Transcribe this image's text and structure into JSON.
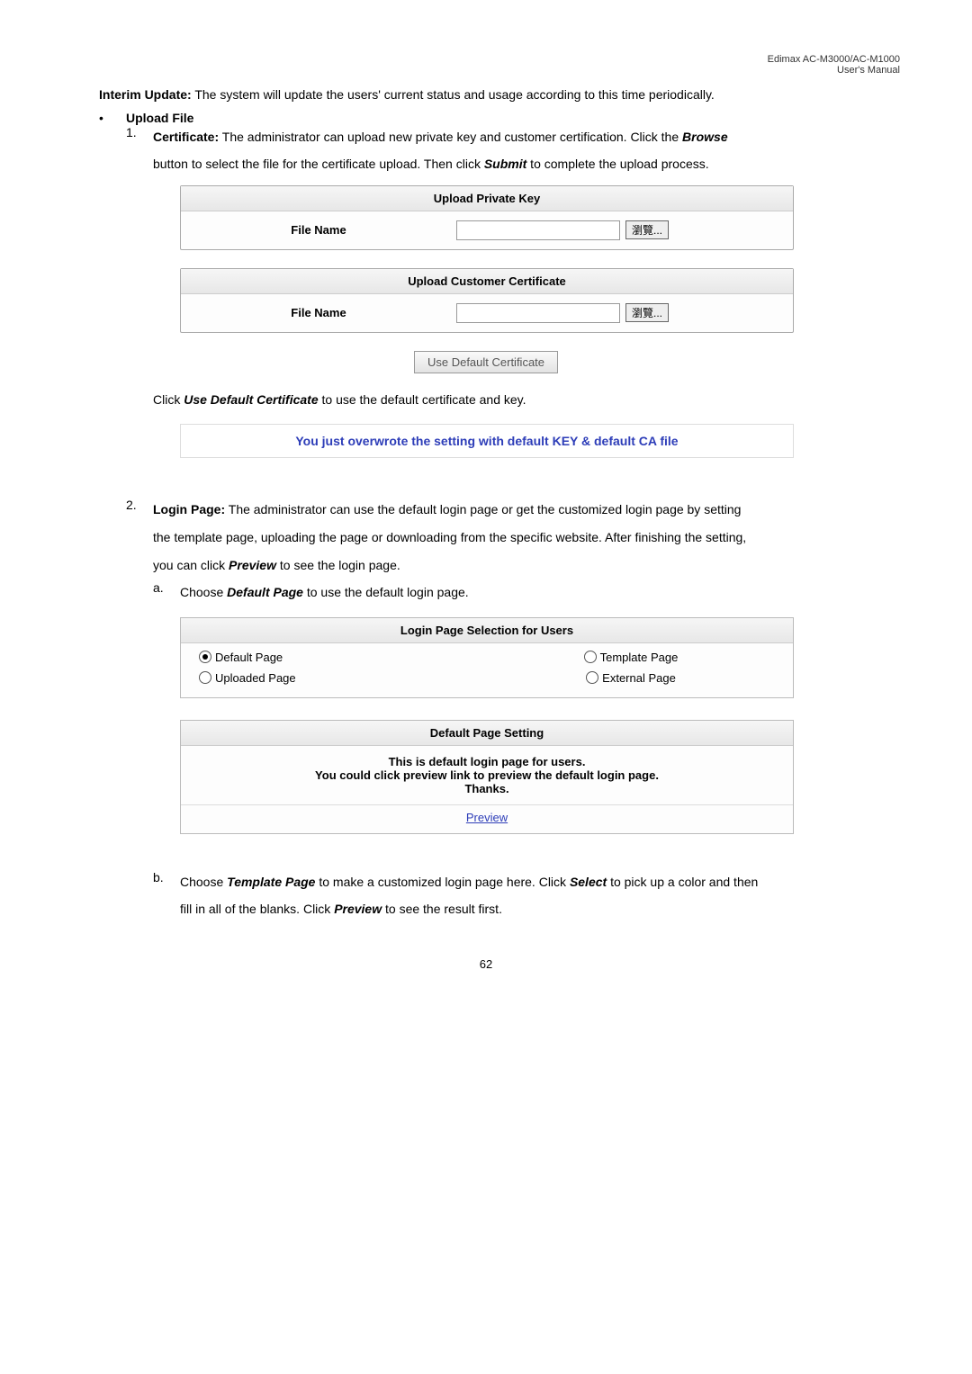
{
  "header": {
    "product": "Edimax  AC-M3000/AC-M1000",
    "manual": "User's  Manual"
  },
  "p1": {
    "label": "Interim Update:",
    "text": " The system will update the users' current status and usage according to this time periodically."
  },
  "uploadFile": {
    "bullet": "•",
    "title": "Upload File",
    "item1": {
      "num": "1.",
      "label": "Certificate:",
      "t1": " The administrator can upload new private key and customer certification. Click the ",
      "browse": "Browse",
      "t2": "button to select the file for the certificate upload. Then click ",
      "submit": "Submit",
      "t3": " to complete the upload process."
    }
  },
  "uploadPrivateKey": {
    "title": "Upload Private Key",
    "fileName": "File Name",
    "browseBtn": "瀏覽..."
  },
  "uploadCert": {
    "title": "Upload Customer Certificate",
    "fileName": "File Name",
    "browseBtn": "瀏覽..."
  },
  "useDefaultBtn": "Use Default Certificate",
  "useDefaultText": {
    "t1": "Click ",
    "b": "Use Default Certificate",
    "t2": " to use the default certificate and key."
  },
  "blueBanner": "You just overwrote the setting with default KEY & default CA file",
  "loginPage": {
    "num": "2.",
    "label": "Login Page:",
    "t1": " The administrator can use the default login page or get the customized login page by setting ",
    "t2": "the template page, uploading the page or downloading from the specific website. After finishing the setting, ",
    "t3": "you can click ",
    "preview": "Preview",
    "t4": " to see the login page."
  },
  "subA": {
    "mark": "a.",
    "t1": "Choose ",
    "b": "Default Page",
    "t2": " to use the default login page."
  },
  "loginPanel": {
    "title": "Login Page Selection for Users",
    "opt1": "Default Page",
    "opt2": "Template Page",
    "opt3": "Uploaded Page",
    "opt4": "External Page",
    "settingTitle": "Default Page Setting",
    "line1": "This is default login page for users.",
    "line2": "You could click preview link to preview the default login page.",
    "line3": "Thanks.",
    "previewLink": "Preview"
  },
  "subB": {
    "mark": "b.",
    "t1": "Choose ",
    "b1": "Template Page",
    "t2": " to make a customized login page here. Click ",
    "b2": "Select",
    "t3": " to pick up a color and then ",
    "t4": "fill in all of the blanks. Click ",
    "b3": "Preview",
    "t5": " to see the result first."
  },
  "pageNum": "62"
}
